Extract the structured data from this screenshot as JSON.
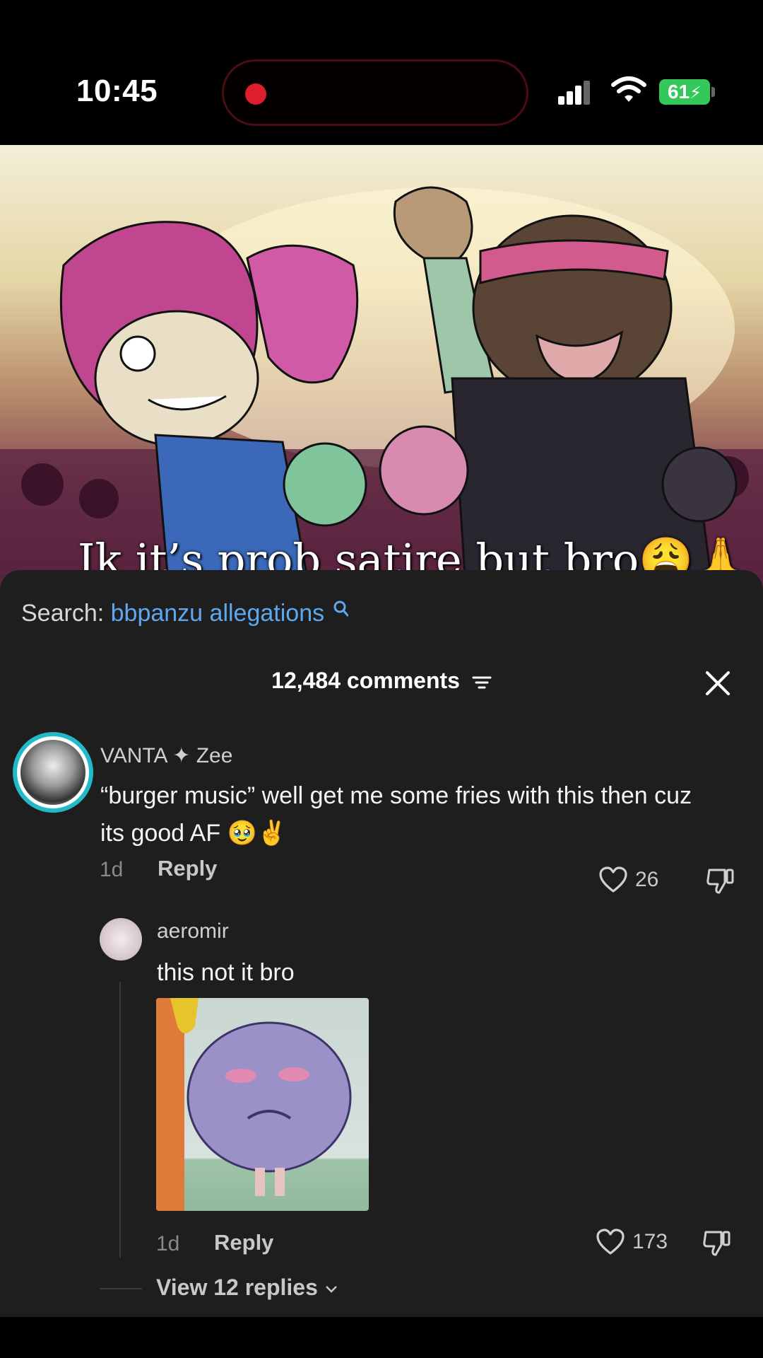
{
  "status_bar": {
    "time": "10:45",
    "battery": "61",
    "battery_color": "#34c759",
    "recording_color": "#e01e2b"
  },
  "video": {
    "caption": "Ik it’s prob satire but bro😩🙏"
  },
  "search": {
    "label": "Search:",
    "query": "bbpanzu allegations"
  },
  "comments_header": {
    "count_label": "12,484 comments"
  },
  "comments": [
    {
      "username_fancy": "𝓥𝓐𝓝𝓣𝓐",
      "username": "VANTA ✦ Zee",
      "username_rest": "✦ Zee",
      "text": "“burger music” well get me some fries with this then cuz its good AF 🥹✌️",
      "age": "1d",
      "reply_label": "Reply",
      "likes": "26",
      "avatar_ring_color": "#22b9c8"
    },
    {
      "username": "aeromir",
      "text": "this not it bro",
      "age": "1d",
      "reply_label": "Reply",
      "likes": "173",
      "has_image": true
    }
  ],
  "view_replies": {
    "label": "View 12 replies"
  },
  "icons": {
    "search": "search-icon",
    "filter": "filter-icon",
    "close": "close-icon",
    "like": "heart-icon",
    "dislike": "thumbs-down-icon",
    "chevron": "chevron-down-icon"
  }
}
